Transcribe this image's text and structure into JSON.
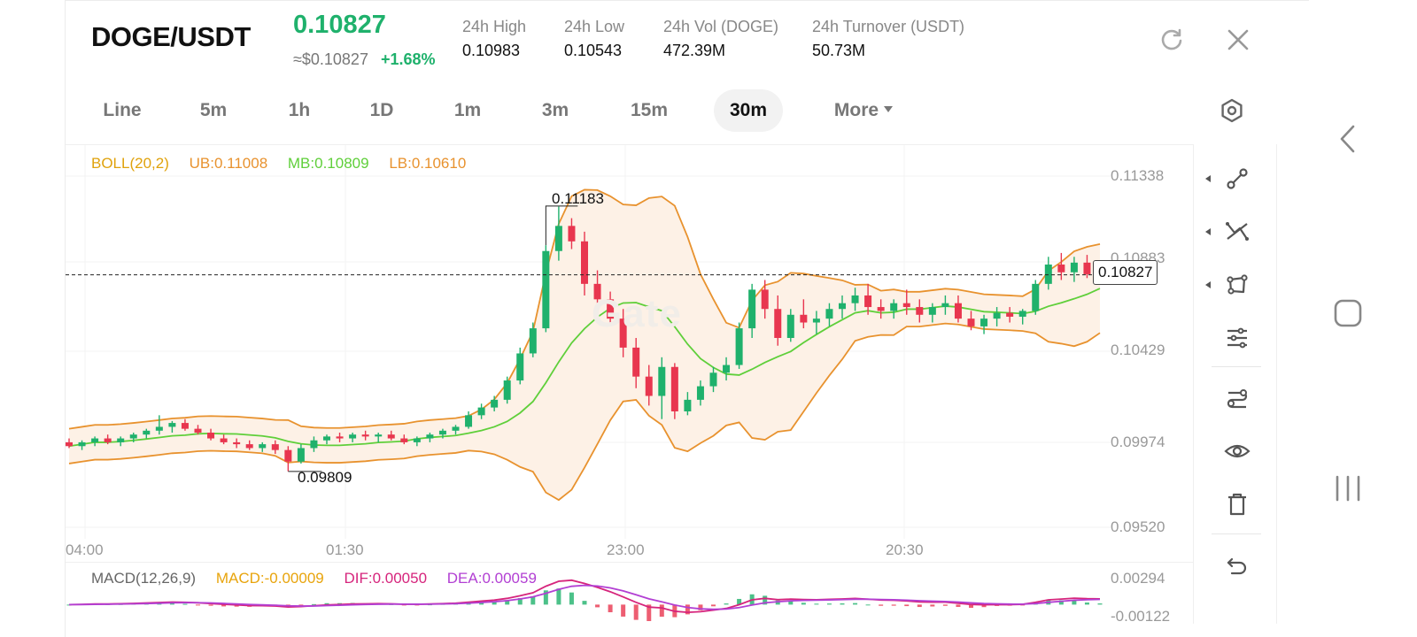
{
  "header": {
    "pair": "DOGE/USDT",
    "last_price": "0.10827",
    "approx_usd": "≈$0.10827",
    "change_pct": "+1.68%",
    "stats": [
      {
        "label": "24h   High",
        "value": "0.10983"
      },
      {
        "label": "24h   Low",
        "value": "0.10543"
      },
      {
        "label": "24h   Vol (DOGE)",
        "value": "472.39M"
      },
      {
        "label": "24h   Turnover (USDT)",
        "value": "50.73M"
      }
    ],
    "icons": [
      "refresh-icon",
      "close-icon"
    ]
  },
  "intervals": {
    "tabs": [
      "Line",
      "5m",
      "1h",
      "1D",
      "1m",
      "3m",
      "15m",
      "30m",
      "More"
    ],
    "active": "30m"
  },
  "boll": {
    "name": "BOLL(20,2)",
    "ub": "UB:0.11008",
    "mb": "MB:0.10809",
    "lb": "LB:0.10610"
  },
  "macd": {
    "name": "MACD(12,26,9)",
    "macd": "MACD:-0.00009",
    "dif": "DIF:0.00050",
    "dea": "DEA:0.00059",
    "y_ticks": [
      "0.00294",
      "-0.00122"
    ]
  },
  "chart": {
    "y_ticks": [
      "0.11338",
      "0.10883",
      "0.10429",
      "0.09974",
      "0.09520"
    ],
    "x_ticks": [
      "04:00",
      "01:30",
      "23:00",
      "20:30"
    ],
    "current_price": "0.10827",
    "high_mark": "0.11183",
    "low_mark": "0.09809",
    "watermark": "Gate"
  },
  "colors": {
    "up": "#1fb16c",
    "down": "#e8364f",
    "boll_band": "#e8922e",
    "boll_mid": "#5fcf3a",
    "dif": "#d6247c",
    "dea": "#b23fd3",
    "macd": "#e8a40c",
    "band_fill": "#fdf1e6"
  },
  "chart_data": {
    "type": "candlestick",
    "ylim": [
      0.0952,
      0.11338
    ],
    "y_ticks": [
      0.11338,
      0.10883,
      0.10429,
      0.09974,
      0.0952
    ],
    "x_ticks": [
      "04:00",
      "01:30",
      "23:00",
      "20:30"
    ],
    "last": 0.10827,
    "high_marker": 0.11183,
    "low_marker": 0.09809,
    "boll": {
      "ub": 0.11008,
      "mb": 0.10809,
      "lb": 0.1061
    },
    "macd": {
      "macd": -9e-05,
      "dif": 0.0005,
      "dea": 0.00059,
      "ylim": [
        -0.00122,
        0.00294
      ]
    },
    "candles": [
      [
        0.0996,
        0.0998,
        0.0993,
        0.0994
      ],
      [
        0.0994,
        0.0997,
        0.0992,
        0.0996
      ],
      [
        0.0996,
        0.0999,
        0.0994,
        0.0998
      ],
      [
        0.0998,
        0.1,
        0.0995,
        0.0996
      ],
      [
        0.0996,
        0.0999,
        0.0994,
        0.0998
      ],
      [
        0.0998,
        0.1001,
        0.0996,
        0.1
      ],
      [
        0.1,
        0.1003,
        0.0998,
        0.1002
      ],
      [
        0.1002,
        0.101,
        0.1,
        0.1004
      ],
      [
        0.1004,
        0.1007,
        0.1001,
        0.1006
      ],
      [
        0.1006,
        0.1008,
        0.1002,
        0.1003
      ],
      [
        0.1003,
        0.1005,
        0.1,
        0.1001
      ],
      [
        0.1001,
        0.1003,
        0.0997,
        0.0998
      ],
      [
        0.0998,
        0.1,
        0.0995,
        0.0996
      ],
      [
        0.0996,
        0.0998,
        0.0993,
        0.0995
      ],
      [
        0.0995,
        0.0997,
        0.0992,
        0.0993
      ],
      [
        0.0993,
        0.0996,
        0.0991,
        0.0995
      ],
      [
        0.0995,
        0.0997,
        0.099,
        0.0992
      ],
      [
        0.0992,
        0.0994,
        0.0981,
        0.0986
      ],
      [
        0.0986,
        0.0995,
        0.0985,
        0.0993
      ],
      [
        0.0993,
        0.0999,
        0.0991,
        0.0997
      ],
      [
        0.0997,
        0.1,
        0.0995,
        0.0999
      ],
      [
        0.0999,
        0.1001,
        0.0996,
        0.0998
      ],
      [
        0.0998,
        0.1001,
        0.0996,
        0.1
      ],
      [
        0.1,
        0.1002,
        0.0997,
        0.0999
      ],
      [
        0.0999,
        0.1001,
        0.0996,
        0.1
      ],
      [
        0.1,
        0.1002,
        0.0997,
        0.0998
      ],
      [
        0.0998,
        0.1,
        0.0995,
        0.0996
      ],
      [
        0.0996,
        0.0999,
        0.0994,
        0.0998
      ],
      [
        0.0998,
        0.1001,
        0.0996,
        0.1
      ],
      [
        0.1,
        0.1003,
        0.0998,
        0.1002
      ],
      [
        0.1002,
        0.1005,
        0.1,
        0.1004
      ],
      [
        0.1004,
        0.1012,
        0.1003,
        0.101
      ],
      [
        0.101,
        0.1016,
        0.1008,
        0.1014
      ],
      [
        0.1014,
        0.102,
        0.1012,
        0.1018
      ],
      [
        0.1018,
        0.103,
        0.1016,
        0.1028
      ],
      [
        0.1028,
        0.1045,
        0.1026,
        0.1042
      ],
      [
        0.1042,
        0.1058,
        0.104,
        0.1055
      ],
      [
        0.1055,
        0.1098,
        0.1053,
        0.1095
      ],
      [
        0.1095,
        0.1118,
        0.109,
        0.1108
      ],
      [
        0.1108,
        0.1112,
        0.1096,
        0.11
      ],
      [
        0.11,
        0.1105,
        0.1072,
        0.1078
      ],
      [
        0.1078,
        0.1085,
        0.1066,
        0.107
      ],
      [
        0.107,
        0.1074,
        0.1056,
        0.106
      ],
      [
        0.106,
        0.1065,
        0.104,
        0.1045
      ],
      [
        0.1045,
        0.105,
        0.1024,
        0.103
      ],
      [
        0.103,
        0.1036,
        0.1015,
        0.102
      ],
      [
        0.102,
        0.104,
        0.1008,
        0.1035
      ],
      [
        0.1035,
        0.1037,
        0.1008,
        0.1012
      ],
      [
        0.1012,
        0.1022,
        0.101,
        0.1018
      ],
      [
        0.1018,
        0.1028,
        0.1015,
        0.1025
      ],
      [
        0.1025,
        0.1035,
        0.1022,
        0.1032
      ],
      [
        0.1032,
        0.104,
        0.1028,
        0.1036
      ],
      [
        0.1036,
        0.1058,
        0.1034,
        0.1055
      ],
      [
        0.1055,
        0.1078,
        0.105,
        0.1075
      ],
      [
        0.1075,
        0.108,
        0.106,
        0.1065
      ],
      [
        0.1065,
        0.1072,
        0.1046,
        0.105
      ],
      [
        0.105,
        0.1065,
        0.1048,
        0.1062
      ],
      [
        0.1062,
        0.107,
        0.1055,
        0.1058
      ],
      [
        0.1058,
        0.1064,
        0.1052,
        0.106
      ],
      [
        0.106,
        0.1068,
        0.1056,
        0.1065
      ],
      [
        0.1065,
        0.1072,
        0.106,
        0.1068
      ],
      [
        0.1068,
        0.1076,
        0.1064,
        0.1072
      ],
      [
        0.1072,
        0.1078,
        0.1062,
        0.1066
      ],
      [
        0.1066,
        0.107,
        0.106,
        0.1064
      ],
      [
        0.1064,
        0.107,
        0.106,
        0.1068
      ],
      [
        0.1068,
        0.1075,
        0.1062,
        0.1066
      ],
      [
        0.1066,
        0.107,
        0.1058,
        0.1062
      ],
      [
        0.1062,
        0.1068,
        0.1058,
        0.1066
      ],
      [
        0.1066,
        0.1072,
        0.1062,
        0.1068
      ],
      [
        0.1068,
        0.1072,
        0.1058,
        0.106
      ],
      [
        0.106,
        0.1064,
        0.1054,
        0.1056
      ],
      [
        0.1056,
        0.1062,
        0.1052,
        0.106
      ],
      [
        0.106,
        0.1066,
        0.1056,
        0.1063
      ],
      [
        0.1063,
        0.1066,
        0.1058,
        0.1061
      ],
      [
        0.1061,
        0.1065,
        0.1057,
        0.1064
      ],
      [
        0.1064,
        0.108,
        0.1062,
        0.1078
      ],
      [
        0.1078,
        0.1092,
        0.1075,
        0.1088
      ],
      [
        0.1088,
        0.1094,
        0.108,
        0.1084
      ],
      [
        0.1084,
        0.1092,
        0.1079,
        0.1089
      ],
      [
        0.1089,
        0.1093,
        0.1081,
        0.1083
      ],
      [
        0.1083,
        0.1089,
        0.108,
        0.1086
      ]
    ]
  }
}
